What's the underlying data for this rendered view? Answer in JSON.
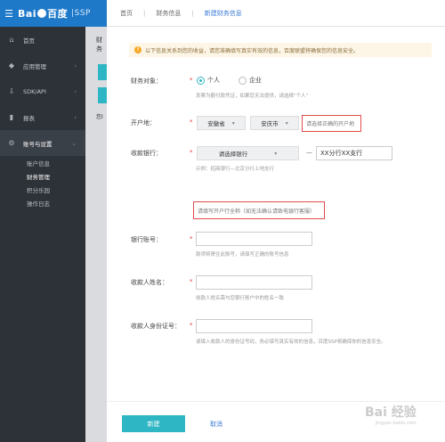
{
  "header": {
    "logo_text": "Bai",
    "logo_cn": "百度",
    "logo_suffix": "|SSP",
    "breadcrumb": [
      "首页",
      "财务信息",
      "新建财务信息"
    ]
  },
  "sidebar": {
    "items": [
      {
        "label": "首页",
        "icon": "home-icon"
      },
      {
        "label": "应用管理",
        "icon": "cube-icon"
      },
      {
        "label": "SDK/API",
        "icon": "download-icon"
      },
      {
        "label": "报表",
        "icon": "bar-chart-icon"
      },
      {
        "label": "账号与设置",
        "icon": "gear-icon"
      }
    ],
    "sub_items": [
      "账户信息",
      "财务管理",
      "积分乐园",
      "操作日志"
    ]
  },
  "background": {
    "tab_text": "财务",
    "side_text": "您I"
  },
  "notice": {
    "text": "以下信息关系到您的收益，请您准确填写真实有效的信息，百度联盟将确保您的信息安全。"
  },
  "form": {
    "subject": {
      "label": "财务对象：",
      "options": [
        "个人",
        "企业"
      ],
      "selected": "个人",
      "hint": "发票为额付款凭证，如果您无法提供，请选择\"个人\""
    },
    "bank_location": {
      "label": "开户地：",
      "province": "安徽省",
      "city": "安庆市",
      "error": "请选择正确的开户地"
    },
    "bank": {
      "label": "收款银行：",
      "select_placeholder": "请选择银行",
      "branch_value": "XX分行XX支行",
      "hint": "示例：招商银行—北京分行上地支行",
      "error": "请填写开户行全称（如无法确认请致电银行客服）"
    },
    "account": {
      "label": "银行账号：",
      "value": "",
      "hint": "款项将寄往此账号，请填写正确的账号信息"
    },
    "payee_name": {
      "label": "收款人姓名：",
      "value": "",
      "hint": "收款人姓名需与您银行账户中的姓名一致"
    },
    "payee_id": {
      "label": "收款人身份证号：",
      "value": "",
      "hint": "请填入收款人的身份证号码，务必填写真实有效的信息，百度SSP将确保你的信息安全。"
    },
    "required_mark": "*"
  },
  "footer": {
    "submit_label": "新建",
    "cancel_label": "取消"
  },
  "watermark": {
    "text": "Bai 经验",
    "sub": "jingyan.baidu.com"
  },
  "colors": {
    "brand_blue": "#1f79c9",
    "accent_teal": "#2fb6c4",
    "error_red": "#e14b4b",
    "sidebar_bg": "#2d3238"
  }
}
